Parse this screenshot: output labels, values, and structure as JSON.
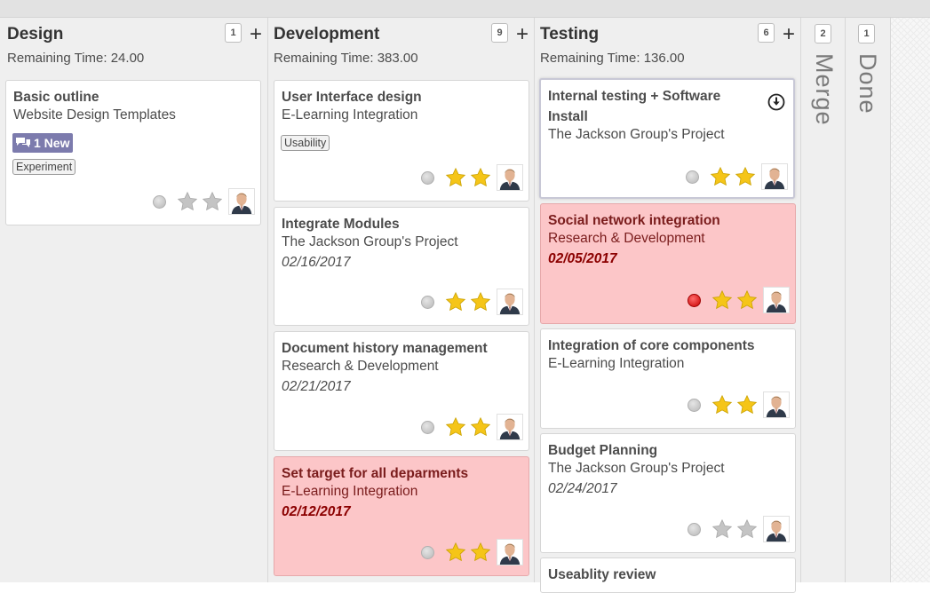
{
  "columns": [
    {
      "title": "Design",
      "count": "1",
      "remaining": "Remaining Time: 24.00",
      "cards": [
        {
          "title": "Basic outline",
          "project": "Website Design Templates",
          "new_badge": "1 New",
          "tag": "Experiment",
          "state": "normal",
          "stars": 0
        }
      ]
    },
    {
      "title": "Development",
      "count": "9",
      "remaining": "Remaining Time: 383.00",
      "cards": [
        {
          "title": "User Interface design",
          "project": "E-Learning Integration",
          "tag": "Usability",
          "state": "normal",
          "stars": 2
        },
        {
          "title": "Integrate Modules",
          "project": "The Jackson Group's Project",
          "date": "02/16/2017",
          "state": "normal",
          "stars": 2
        },
        {
          "title": "Document history management",
          "project": "Research & Development",
          "date": "02/21/2017",
          "state": "normal",
          "stars": 2
        },
        {
          "title": "Set target for all deparments",
          "project": "E-Learning Integration",
          "date": "02/12/2017",
          "state": "normal",
          "stars": 2,
          "overdue": true
        }
      ]
    },
    {
      "title": "Testing",
      "count": "6",
      "remaining": "Remaining Time: 136.00",
      "cards": [
        {
          "title": "Internal testing + Software Install",
          "project": "The Jackson Group's Project",
          "state": "normal",
          "stars": 2,
          "selected": true
        },
        {
          "title": "Social network integration",
          "project": "Research & Development",
          "date": "02/05/2017",
          "state": "blocked",
          "stars": 2,
          "overdue": true
        },
        {
          "title": "Integration of core components",
          "project": "E-Learning Integration",
          "state": "normal",
          "stars": 2
        },
        {
          "title": "Budget Planning",
          "project": "The Jackson Group's Project",
          "date": "02/24/2017",
          "state": "normal",
          "stars": 0
        },
        {
          "title": "Useablity review"
        }
      ]
    }
  ],
  "folded_columns": [
    {
      "title": "Merge",
      "count": "2"
    },
    {
      "title": "Done",
      "count": "1"
    }
  ],
  "colors": {
    "column_bg": "#efefef",
    "overdue_card_bg": "#fcc6c8",
    "new_badge_bg": "#7c7bad",
    "star_on": "#f5c518",
    "star_off": "#c0c0c0",
    "blocked_dot": "#d40000"
  },
  "icons": {
    "new_badge": "message-icon",
    "card_action": "download-circle-icon",
    "priority": "star-icon",
    "status": "status-dot-icon",
    "assignee": "avatar"
  }
}
